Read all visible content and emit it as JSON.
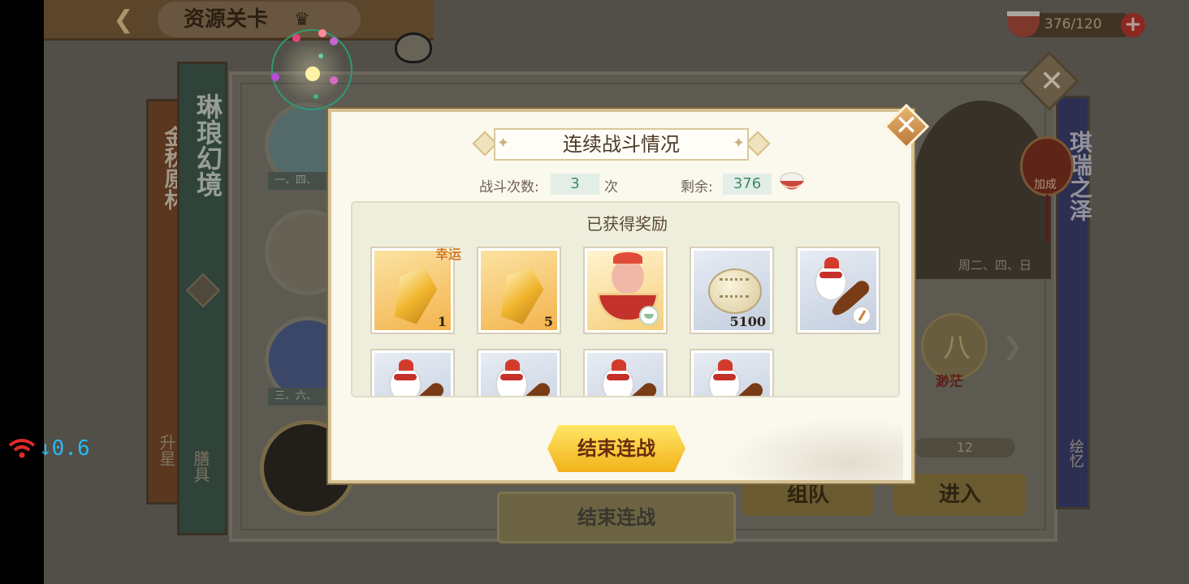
{
  "status": {
    "network_speed": "↓0.6"
  },
  "header": {
    "title": "资源关卡",
    "back_icon": "back-arrow-icon"
  },
  "stamina": {
    "current": "376",
    "max": "/120",
    "add_label": "+"
  },
  "left_banners": {
    "gold": {
      "title": "金秋原林",
      "footer": "升星"
    },
    "teal": {
      "title": "琳琅幻境",
      "footer": "膳具"
    }
  },
  "characters": {
    "tag_1": "一、四、",
    "tag_3": "三、六、"
  },
  "right_panel": {
    "banner_title": "琪瑞之泽",
    "banner_footer": "绘忆",
    "bonus_label": "加成",
    "schedule": "周二、四、日",
    "stage_char": "八",
    "stage_name": "渺茫",
    "count": "12",
    "team_button": "组队",
    "enter_button": "进入",
    "bg_end_button": "结束连战"
  },
  "dialog": {
    "title": "连续战斗情况",
    "battles_label": "战斗次数:",
    "battles_value": "3",
    "battles_unit": "次",
    "remain_label": "剩余:",
    "remain_value": "376",
    "rewards_title": "已获得奖励",
    "lucky_label": "幸运",
    "end_button": "结束连战",
    "close_icon": "close-icon",
    "rewards": [
      {
        "item": "gold-crystal",
        "qty": "1",
        "lucky": true
      },
      {
        "item": "gold-crystal",
        "qty": "5",
        "lucky": false
      },
      {
        "item": "bowl-character-card",
        "qty": "",
        "lucky": false
      },
      {
        "item": "shell",
        "qty": "5100",
        "lucky": false
      },
      {
        "item": "spoon-critter-card",
        "qty": "",
        "lucky": false
      },
      {
        "item": "spoon-critter-card",
        "qty": "",
        "lucky": false
      },
      {
        "item": "spoon-critter-card",
        "qty": "",
        "lucky": false
      },
      {
        "item": "spoon-critter-card",
        "qty": "",
        "lucky": false
      },
      {
        "item": "spoon-critter-card",
        "qty": "",
        "lucky": false
      }
    ]
  },
  "colors": {
    "accent_gold": "#f2b21a",
    "counter_green": "#3e8a63",
    "lucky_orange": "#d17a14",
    "network_blue": "#2bb7f0",
    "network_red": "#e02a2a"
  }
}
